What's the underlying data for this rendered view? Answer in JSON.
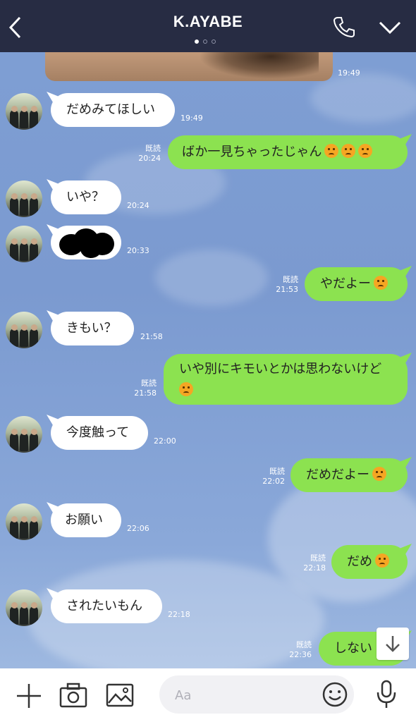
{
  "header": {
    "title": "K.AYABE",
    "page_dots": 3,
    "active_dot": 0
  },
  "messages": [
    {
      "side": "in",
      "text": "だめみてほしい",
      "time": "19:49"
    },
    {
      "side": "out",
      "text": "ばか一見ちゃったじゃん",
      "emojis": 3,
      "read": "既読",
      "time": "20:24"
    },
    {
      "side": "in",
      "text": "いや？",
      "time": "20:24"
    },
    {
      "side": "in",
      "text": "",
      "time": "20:33"
    },
    {
      "side": "out",
      "text": "やだよー",
      "emojis": 1,
      "read": "既読",
      "time": "21:53"
    },
    {
      "side": "in",
      "text": "きもい？",
      "time": "21:58"
    },
    {
      "side": "out",
      "line1": "いや別にキモいとかは思わないけど",
      "emojis": 1,
      "read": "既読",
      "time": "21:58"
    },
    {
      "side": "in",
      "text": "今度触って",
      "time": "22:00"
    },
    {
      "side": "out",
      "text": "だめだよー",
      "emojis": 1,
      "read": "既読",
      "time": "22:02"
    },
    {
      "side": "in",
      "text": "お願い",
      "time": "22:06"
    },
    {
      "side": "out",
      "text": "だめ",
      "emojis": 1,
      "read": "既読",
      "time": "22:18"
    },
    {
      "side": "in",
      "text": "されたいもん",
      "time": "22:18"
    },
    {
      "side": "out",
      "text": "しない",
      "read": "既読",
      "time": "22:36"
    }
  ],
  "image_message": {
    "time": "19:49"
  },
  "composer": {
    "placeholder": "Aa"
  },
  "icons": {
    "back": "chevron-left-icon",
    "call": "phone-icon",
    "menu": "chevron-down-icon",
    "add": "plus-icon",
    "camera": "camera-icon",
    "gallery": "image-icon",
    "emoji": "smiley-icon",
    "voice": "microphone-icon",
    "scroll": "arrow-down-icon"
  },
  "colors": {
    "header_bg": "#272c43",
    "outgoing_bubble": "#8ce250",
    "incoming_bubble": "#ffffff",
    "chat_bg": "#7f9fd4"
  }
}
